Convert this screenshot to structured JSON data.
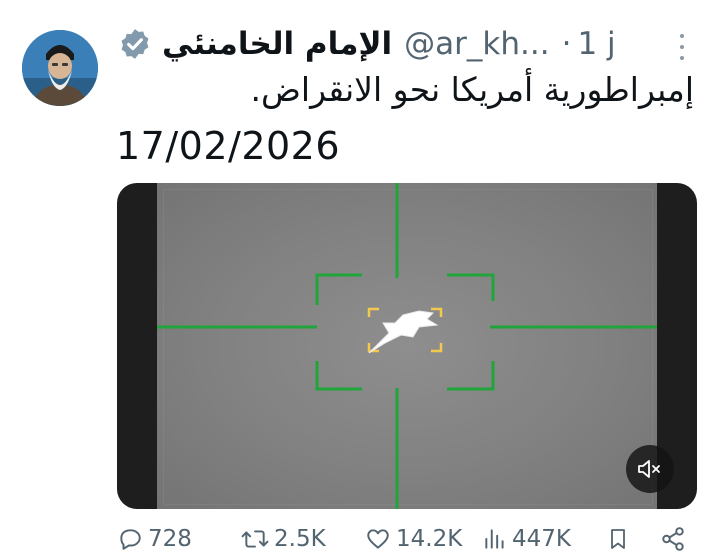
{
  "author": {
    "display_name": "الإمام الخامنئي",
    "handle": "@ar_kh...",
    "separator": "·",
    "time": "1 j",
    "verified_color": "#829aab"
  },
  "tweet": {
    "text": "إمبراطورية أمريكا نحو الانقراض.",
    "date": "17/02/2026"
  },
  "media": {
    "type": "video",
    "reticle_color": "#1fa53a",
    "target_box_color": "#f2c94c"
  },
  "actions": {
    "replies": "728",
    "reposts": "2.5K",
    "likes": "14.2K",
    "views": "447K"
  }
}
